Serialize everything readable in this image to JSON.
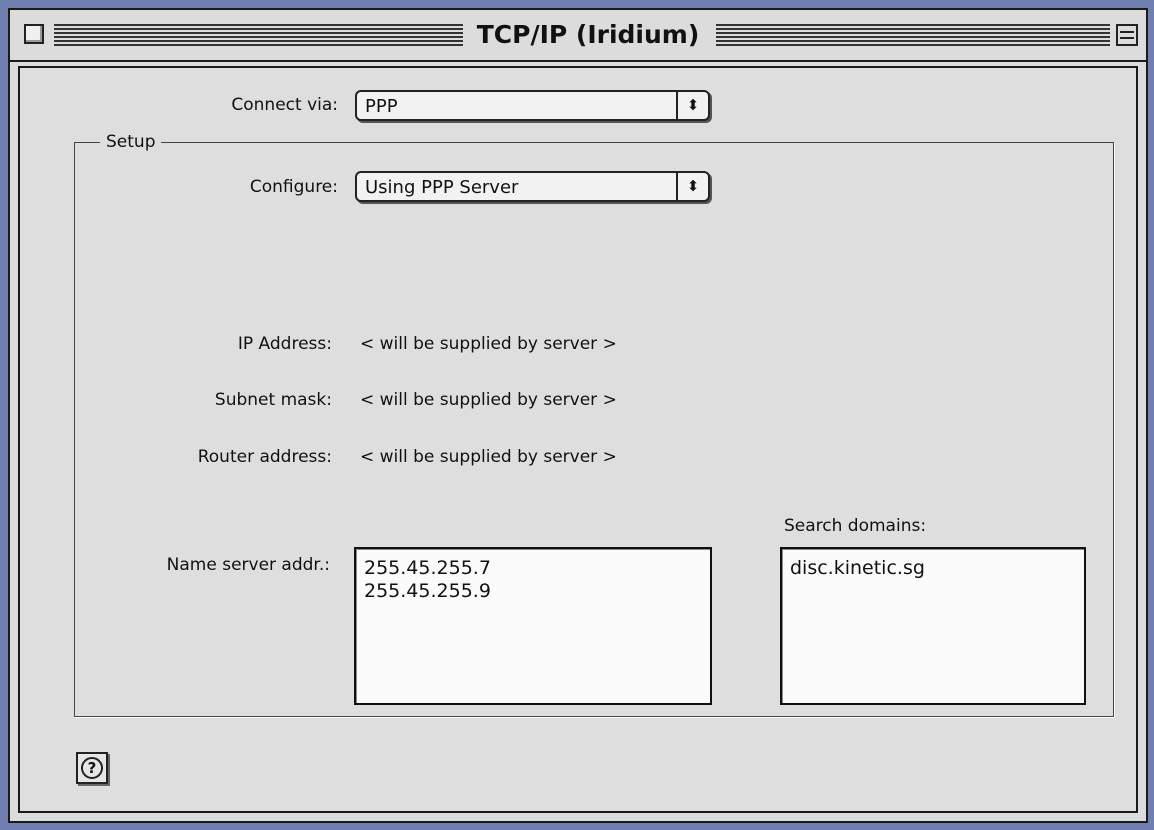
{
  "window": {
    "title": "TCP/IP (Iridium)"
  },
  "connect_via": {
    "label": "Connect via:",
    "value": "PPP"
  },
  "setup": {
    "group_label": "Setup",
    "configure": {
      "label": "Configure:",
      "value": "Using PPP Server"
    },
    "ip_address": {
      "label": "IP Address:",
      "value": "< will be supplied by server >"
    },
    "subnet_mask": {
      "label": "Subnet mask:",
      "value": "< will be supplied by server >"
    },
    "router_address": {
      "label": "Router address:",
      "value": "< will be supplied by server >"
    },
    "name_server": {
      "label": "Name server addr.:",
      "entries": [
        "255.45.255.7",
        "255.45.255.9"
      ]
    },
    "search_domains": {
      "label": "Search domains:",
      "entries": [
        "disc.kinetic.sg"
      ]
    }
  },
  "help": {
    "icon": "help-icon",
    "glyph": "?"
  },
  "icons": {
    "close": "close-box-icon",
    "zoom": "zoom-box-icon",
    "popup_arrows": "updown-arrows-icon"
  },
  "colors": {
    "window_bg": "#dcdcdc",
    "desktop": "#6f7fb0",
    "list_bg": "#fbfbfb"
  }
}
